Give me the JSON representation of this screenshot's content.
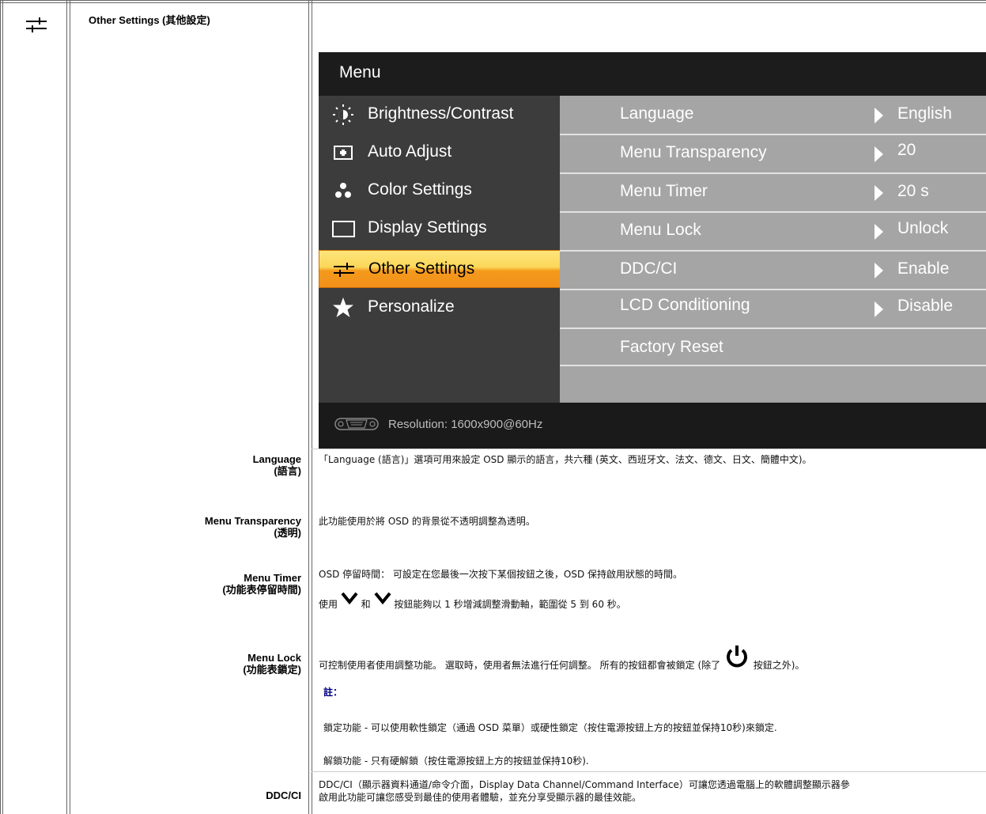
{
  "header": {
    "title": "Other Settings (其他設定)",
    "icon": "settings-sliders-icon"
  },
  "osd": {
    "title": "Menu",
    "menu_items": [
      {
        "label": "Brightness/Contrast",
        "icon": "brightness-icon"
      },
      {
        "label": "Auto Adjust",
        "icon": "auto-adjust-icon"
      },
      {
        "label": "Color Settings",
        "icon": "color-settings-icon"
      },
      {
        "label": "Display Settings",
        "icon": "display-settings-icon"
      },
      {
        "label": "Other Settings",
        "icon": "other-settings-icon",
        "selected": true
      },
      {
        "label": "Personalize",
        "icon": "star-icon"
      }
    ],
    "options": [
      {
        "name": "Language",
        "value": "English"
      },
      {
        "name": "Menu Transparency",
        "value": "20"
      },
      {
        "name": "Menu Timer",
        "value": "20 s"
      },
      {
        "name": "Menu Lock",
        "value": "Unlock"
      },
      {
        "name": "DDC/CI",
        "value": "Enable"
      },
      {
        "name": "LCD Conditioning",
        "value": "Disable"
      },
      {
        "name": "Factory Reset",
        "value": ""
      }
    ],
    "footer": "Resolution: 1600x900@60Hz"
  },
  "rows": {
    "language": {
      "label_en": "Language",
      "label_zh": "(語言)",
      "desc": "「Language (語言)」選項可用來設定 OSD 顯示的語言，共六種 (英文、西班牙文、法文、德文、日文、簡體中文)。"
    },
    "transparency": {
      "label_en": "Menu Transparency",
      "label_zh": "(透明)",
      "desc": "此功能使用於將 OSD 的背景從不透明調整為透明。"
    },
    "timer": {
      "label_en": "Menu Timer",
      "label_zh": "(功能表停留時間)",
      "desc1": "OSD 停留時間： 可設定在您最後一次按下某個按鈕之後，OSD 保持啟用狀態的時間。",
      "desc2_a": "使用",
      "desc2_b": "和",
      "desc2_c": "按鈕能夠以 1 秒增減調整滑動軸，範圍從 5 到 60 秒。"
    },
    "lock": {
      "label_en": "Menu Lock",
      "label_zh": "(功能表鎖定)",
      "desc_a": "可控制使用者使用調整功能。 選取時，使用者無法進行任何調整。 所有的按鈕都會被鎖定 (除了",
      "desc_b": "按鈕之外)。",
      "note_title": "註：",
      "note1": "鎖定功能 - 可以使用軟性鎖定（通過 OSD 菜單）或硬性鎖定（按住電源按鈕上方的按鈕並保持10秒)來鎖定.",
      "note2": "解鎖功能 - 只有硬解鎖（按住電源按鈕上方的按鈕並保持10秒)."
    },
    "ddc": {
      "label_en": "DDC/CI",
      "desc1": "DDC/CI（顯示器資料通道/命令介面，Display Data Channel/Command Interface）可讓您透過電腦上的軟體調整顯示器參",
      "desc2": "啟用此功能可讓您感受到最佳的使用者體驗，並充分享受顯示器的最佳效能。"
    }
  }
}
